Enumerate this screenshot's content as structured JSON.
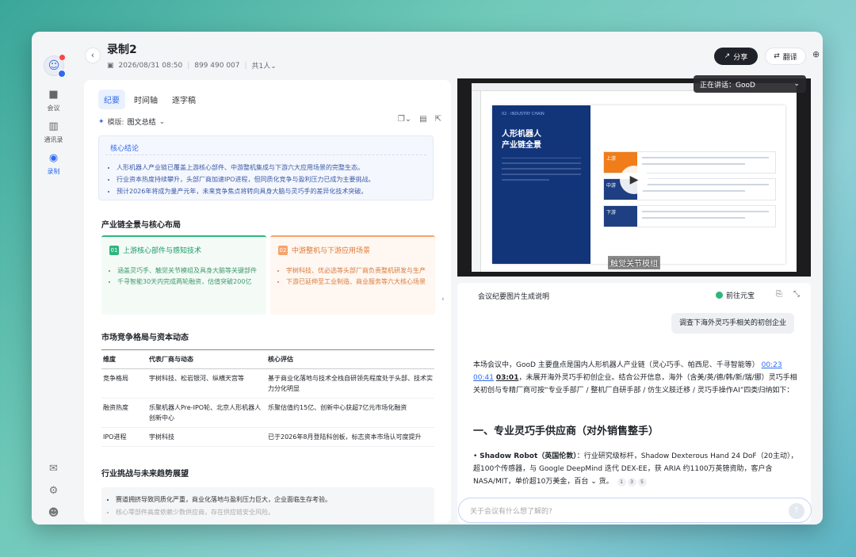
{
  "window": {
    "title": "录制2",
    "date": "2026/08/31 08:50",
    "meeting_id": "899 490 007",
    "people": "共1人"
  },
  "rail": {
    "items": [
      {
        "label": "会议"
      },
      {
        "label": "通讯录"
      },
      {
        "label": "录制"
      }
    ]
  },
  "header": {
    "share": "分享",
    "translate": "翻译"
  },
  "left": {
    "tabs": [
      "纪要",
      "时间轴",
      "逐字稿"
    ],
    "template_label": "模版:",
    "template_value": "图文总结",
    "summary": {
      "heading": "核心结论",
      "items": [
        "人形机器人产业链已覆盖上游核心部件、中游整机集成与下游六大应用场景的完整生态。",
        "行业资本热度持续攀升，头部厂商加速IPO进程，但同质化竞争与盈利压力已成为主要挑战。",
        "预计2026年将成为量产元年，未来竞争焦点将转向具身大脑与灵巧手的差异化技术突破。"
      ]
    },
    "section1": "产业链全景与核心布局",
    "card1": {
      "num": "01",
      "title": "上游核心部件与感知技术",
      "items": [
        "涵盖灵巧手、触觉关节模组及具身大脑等关键部件",
        "千寻智能30天内完成两轮融资，估值突破200亿"
      ]
    },
    "card2": {
      "num": "02",
      "title": "中游整机与下游应用场景",
      "items": [
        "宇树科技、优必选等头部厂商负责整机研发与生产",
        "下游已延伸至工业制造、商业服务等六大核心场景"
      ]
    },
    "section2": "市场竞争格局与资本动态",
    "table": {
      "headers": [
        "维度",
        "代表厂商与动态",
        "核心评估"
      ],
      "rows": [
        [
          "竞争格局",
          "宇树科技、松岩银河、纵横天宫等",
          "基于商业化落地与技术全栈自研领先程度处于头部、技术实力分化明显"
        ],
        [
          "融资热度",
          "乐聚机器人Pre-IPO轮、北京人形机器人创新中心",
          "乐聚估值约15亿、创新中心获超7亿元市场化融资"
        ],
        [
          "IPO进程",
          "宇树科技",
          "已于2026年8月登陆科创板，标志资本市场认可度提升"
        ]
      ]
    },
    "section3": "行业挑战与未来趋势展望",
    "challenges": [
      "赛道拥挤导致同质化严重，商业化落地与盈利压力巨大，企业面临生存考验。",
      "核心零部件高度依赖少数供应商，存在供应链安全风险。"
    ]
  },
  "video": {
    "speaking": "正在讲话：GooD",
    "subtitle": "触觉关节模组",
    "slide_title_1": "人形机器人",
    "slide_title_2": "产业链全景",
    "row_labels": [
      "上游",
      "中游",
      "下游"
    ]
  },
  "chat": {
    "header": "会议纪要图片生成说明",
    "yuanbao": "前往元宝",
    "question": "调查下海外灵巧手相关的初创企业",
    "answer_1": "本场会议中，GooD 主要盘点是国内人形机器人产业链（灵心巧手、帕西尼、千寻智能等）",
    "ts": [
      "00:23",
      "00:41",
      "03:01"
    ],
    "answer_2": "，未展开海外灵巧手初创企业。结合公开信息，海外（含美/英/德/韩/新/瑞/挪）灵巧手相关初创与专精厂商可按“专业手部厂 / 整机厂自研手部 / 仿生义肢迁移 / 灵巧手操作AI”四类归纳如下：",
    "section": "一、专业灵巧手供应商（对外销售整手）",
    "item_name": "Shadow Robot（英国伦敦）",
    "item_text": "：行业研究级标杆，Shadow Dexterous Hand 24 DoF（20主动），超100个传感器，与 Google DeepMind 迭代 DEX-EE，获 ARIA 约1100万英镑资助，客户含 NASA/MIT，单价超10万美金，百台",
    "item_tail": "货。",
    "cites": [
      "1",
      "3",
      "5"
    ],
    "input_placeholder": "关于会议有什么想了解的?"
  }
}
